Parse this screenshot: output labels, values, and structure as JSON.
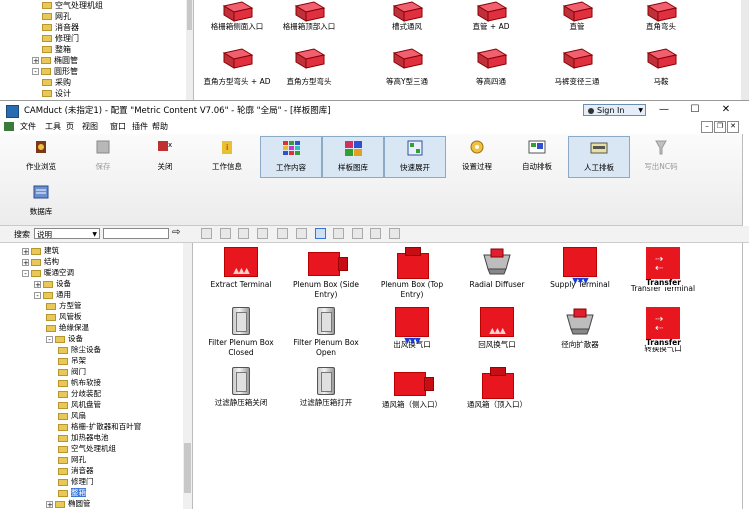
{
  "top_fragment": {
    "tree_items": [
      "空气处理机组",
      "网孔",
      "消音器",
      "修理门",
      "整箱",
      "椭圆管",
      "圆形管",
      "采购",
      "设计"
    ],
    "gallery_row1": [
      "格栅箱侧面入口",
      "格栅箱顶部入口",
      "槽式通风",
      "直管 + AD",
      "直管",
      "直角弯头"
    ],
    "gallery_row2": [
      "直角方型弯头 + AD",
      "直角方型弯头",
      "等高Y型三通",
      "等高四通",
      "马裤变径三通",
      "马鞍"
    ]
  },
  "titlebar": {
    "title": "CAMduct (未指定1) - 配置 \"Metric Content V7.06\" - 轮廓 \"全局\" - [样板图库]",
    "signin": "Sign In",
    "minimize": "—",
    "maximize": "☐",
    "close": "✕"
  },
  "menubar": [
    "文件",
    "工具",
    "页",
    "视图",
    "窗口",
    "插件",
    "帮助"
  ],
  "ribbon": {
    "buttons": [
      {
        "label": "作业浏览",
        "state": "normal"
      },
      {
        "label": "保存",
        "state": "disabled"
      },
      {
        "label": "关闭",
        "state": "normal"
      },
      {
        "label": "工作信息",
        "state": "normal"
      },
      {
        "label": "工作内容",
        "state": "active"
      },
      {
        "label": "样板图库",
        "state": "active"
      },
      {
        "label": "快速展开",
        "state": "active"
      },
      {
        "label": "设置过程",
        "state": "normal"
      },
      {
        "label": "自动排板",
        "state": "normal"
      },
      {
        "label": "人工排板",
        "state": "active"
      },
      {
        "label": "写出NC码",
        "state": "disabled"
      }
    ],
    "row2": [
      "数据库"
    ]
  },
  "search": {
    "label": "搜索",
    "select_value": "说明",
    "query": ""
  },
  "tree": {
    "items": [
      {
        "label": "建筑",
        "level": 1,
        "exp": "+"
      },
      {
        "label": "结构",
        "level": 1,
        "exp": "+"
      },
      {
        "label": "暖通空调",
        "level": 1,
        "exp": "-"
      },
      {
        "label": "设备",
        "level": 2,
        "exp": "+"
      },
      {
        "label": "通用",
        "level": 2,
        "exp": "-"
      },
      {
        "label": "方型管",
        "level": 3,
        "exp": ""
      },
      {
        "label": "风管板",
        "level": 3,
        "exp": ""
      },
      {
        "label": "绝缘保温",
        "level": 3,
        "exp": ""
      },
      {
        "label": "设备",
        "level": 3,
        "exp": "-"
      },
      {
        "label": "除尘设备",
        "level": 4,
        "exp": ""
      },
      {
        "label": "吊架",
        "level": 4,
        "exp": ""
      },
      {
        "label": "阀门",
        "level": 4,
        "exp": ""
      },
      {
        "label": "帆布软接",
        "level": 4,
        "exp": ""
      },
      {
        "label": "分歧装配",
        "level": 4,
        "exp": ""
      },
      {
        "label": "风机盘管",
        "level": 4,
        "exp": ""
      },
      {
        "label": "风扇",
        "level": 4,
        "exp": ""
      },
      {
        "label": "格栅-扩散器和百叶窗",
        "level": 4,
        "exp": ""
      },
      {
        "label": "加热器电池",
        "level": 4,
        "exp": ""
      },
      {
        "label": "空气处理机组",
        "level": 4,
        "exp": ""
      },
      {
        "label": "网孔",
        "level": 4,
        "exp": ""
      },
      {
        "label": "消音器",
        "level": 4,
        "exp": ""
      },
      {
        "label": "修理门",
        "level": 4,
        "exp": ""
      },
      {
        "label": "整箱",
        "level": 4,
        "exp": "",
        "selected": true
      },
      {
        "label": "椭圆管",
        "level": 3,
        "exp": "+"
      }
    ]
  },
  "gallery": {
    "items": [
      {
        "label": "Extract Terminal",
        "kind": "extract"
      },
      {
        "label": "Plenum Box (Side Entry)",
        "kind": "plenum-side"
      },
      {
        "label": "Plenum Box (Top Entry)",
        "kind": "plenum-top"
      },
      {
        "label": "Radial Diffuser",
        "kind": "radial"
      },
      {
        "label": "Supply Terminal",
        "kind": "supply"
      },
      {
        "label": "Transfer Terminal",
        "kind": "transfer"
      },
      {
        "label": "Filter Plenum Box Closed",
        "kind": "filter"
      },
      {
        "label": "Filter Plenum Box Open",
        "kind": "filter"
      },
      {
        "label": "出风换气口",
        "kind": "supply"
      },
      {
        "label": "回风换气口",
        "kind": "extract"
      },
      {
        "label": "径向扩散器",
        "kind": "radial"
      },
      {
        "label": "转换换气口",
        "kind": "transfer"
      },
      {
        "label": "过滤静压箱关闭",
        "kind": "filter"
      },
      {
        "label": "过滤静压箱打开",
        "kind": "filter"
      },
      {
        "label": "通风箱（侧入口）",
        "kind": "plenum-side"
      },
      {
        "label": "通风箱（顶入口）",
        "kind": "plenum-top"
      }
    ],
    "transfer_word": "Transfer"
  }
}
